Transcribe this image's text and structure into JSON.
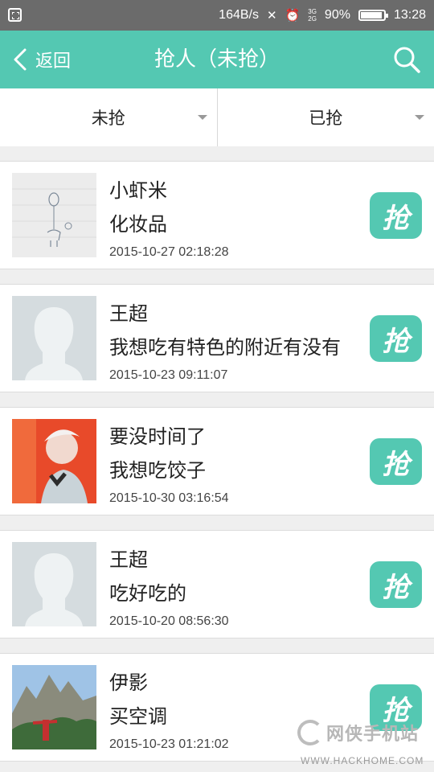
{
  "status_bar": {
    "speed": "164B/s",
    "battery": "90%",
    "time": "13:28",
    "network": "3G 2G"
  },
  "header": {
    "back_label": "返回",
    "title": "抢人（未抢）"
  },
  "tabs": [
    {
      "label": "未抢"
    },
    {
      "label": "已抢"
    }
  ],
  "grab_label": "抢",
  "items": [
    {
      "name": "小虾米",
      "message": "化妆品",
      "time": "2015-10-27 02:18:28",
      "avatar": "sketch-balloon"
    },
    {
      "name": "王超",
      "message": "我想吃有特色的附近有没有",
      "time": "2015-10-23 09:11:07",
      "avatar": "default-silhouette"
    },
    {
      "name": "要没时间了",
      "message": "我想吃饺子",
      "time": "2015-10-30 03:16:54",
      "avatar": "photo-person-red"
    },
    {
      "name": "王超",
      "message": "吃好吃的",
      "time": "2015-10-20 08:56:30",
      "avatar": "default-silhouette"
    },
    {
      "name": "伊影",
      "message": "买空调",
      "time": "2015-10-23 01:21:02",
      "avatar": "photo-mountain"
    }
  ],
  "watermark": {
    "brand": "网侠手机站",
    "url": "WWW.HACKHOME.COM"
  },
  "colors": {
    "accent": "#54c8b2",
    "status_bar": "#6b6b6b"
  }
}
